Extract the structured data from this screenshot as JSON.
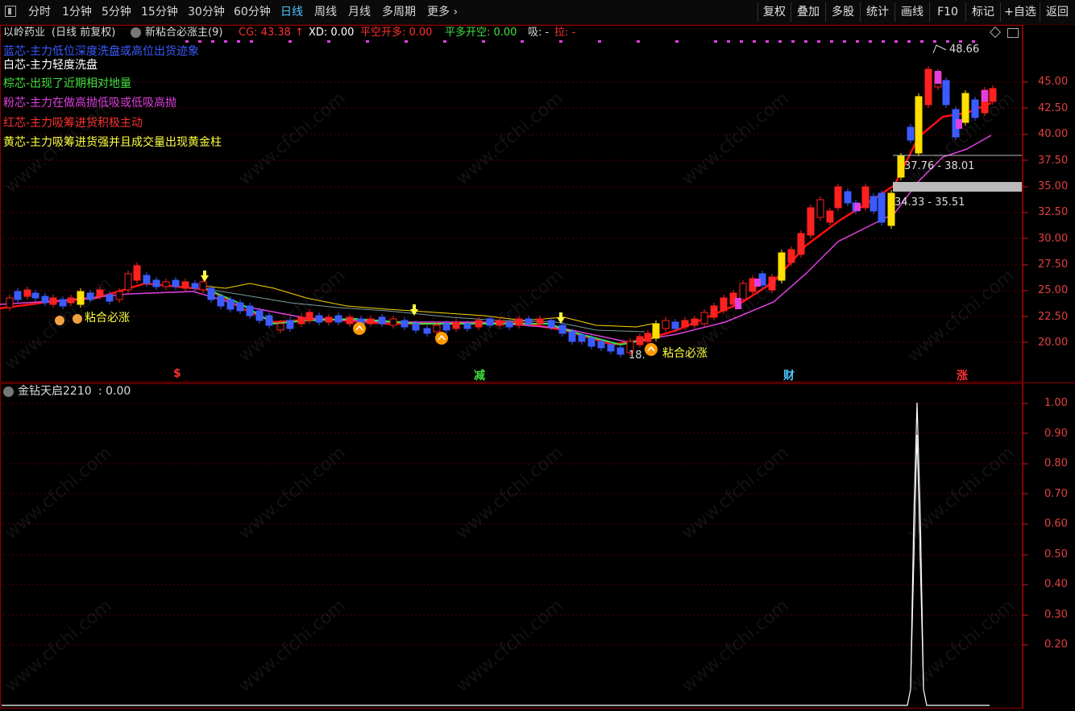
{
  "toolbar": {
    "left_icon": "panel-toggle-icon",
    "periods": [
      "分时",
      "1分钟",
      "5分钟",
      "15分钟",
      "30分钟",
      "60分钟",
      "日线",
      "周线",
      "月线",
      "多周期",
      "更多"
    ],
    "active_period": "日线",
    "right_buttons": [
      "复权",
      "叠加",
      "多股",
      "统计",
      "画线",
      "F10",
      "标记",
      "+自选",
      "返回"
    ]
  },
  "main_header": {
    "stock": "以岭药业",
    "period_info": "(日线 前复权)",
    "indicator": "新粘合必涨主(9)",
    "cg": "CG: 43.38",
    "cg_arrow": "↑",
    "xd": "XD: 0.00",
    "pk": "平空开多: 0.00",
    "pd": "平多开空: 0.00",
    "xi": "吸: -",
    "la": "拉: -"
  },
  "legend": [
    {
      "text": "蓝芯-主力低位深度洗盘或高位出货迹象",
      "color": "#3a5cff"
    },
    {
      "text": "白芯-主力轻度洗盘",
      "color": "#ffffff"
    },
    {
      "text": "棕芯-出现了近期相对地量",
      "color": "#40e040"
    },
    {
      "text": "粉芯-主力在做高抛低吸或低吸高抛",
      "color": "#e040e0"
    },
    {
      "text": "红芯-主力吸筹进货积极主动",
      "color": "#ff3030"
    },
    {
      "text": "黄芯-主力吸筹进货强并且成交量出现黄金柱",
      "color": "#ffff40"
    }
  ],
  "price_axis": [
    "45.00",
    "42.50",
    "40.00",
    "37.50",
    "35.00",
    "32.50",
    "30.00",
    "27.50",
    "25.00",
    "22.50",
    "20.00"
  ],
  "annotations": {
    "high": "48.66",
    "low": "18.",
    "zone1": "37.76 - 38.01",
    "zone2": "34.33 - 35.51",
    "signal1": "粘合必涨",
    "signal2": "粘合必涨"
  },
  "markers": [
    {
      "text": "$",
      "color": "#ff3030"
    },
    {
      "text": "减",
      "color": "#40e040"
    },
    {
      "text": "财",
      "color": "#4fc3ff"
    },
    {
      "text": "涨",
      "color": "#ff3030"
    }
  ],
  "sub_header": {
    "indicator": "金钻天启2210",
    "value": ": 0.00"
  },
  "sub_axis": [
    "1.00",
    "0.90",
    "0.80",
    "0.70",
    "0.60",
    "0.50",
    "0.40",
    "0.30",
    "0.20"
  ],
  "watermark": "www.cfchi.com",
  "colors": {
    "grid": "#5a0000",
    "up": "#ff2020",
    "down": "#3a5cff",
    "ma_red": "#ff1010",
    "ma_pink": "#e040e0",
    "accent": "#4fc3ff"
  }
}
